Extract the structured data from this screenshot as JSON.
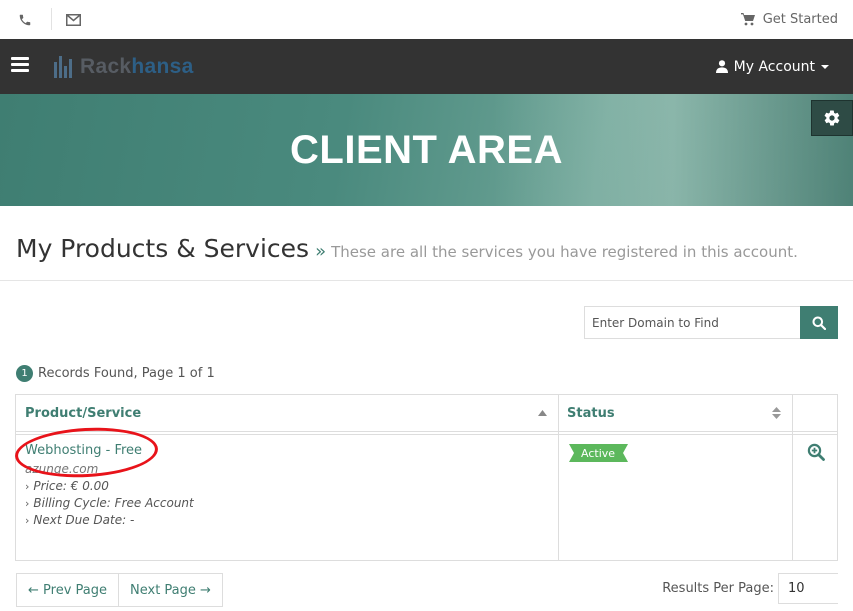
{
  "topbar": {
    "phone_icon": "phone-icon",
    "mail_icon": "envelope-icon",
    "get_started": "Get Started"
  },
  "navbar": {
    "logo": {
      "part1": "Rack",
      "part2": "hansa"
    },
    "account": "My Account"
  },
  "hero": {
    "title": "CLIENT AREA"
  },
  "page": {
    "title": "My Products & Services",
    "separator": "»",
    "subtitle": "These are all the services you have registered in this account."
  },
  "search": {
    "placeholder": "Enter Domain to Find"
  },
  "records": {
    "count": "1",
    "text": "Records Found, Page 1 of 1"
  },
  "table": {
    "headers": {
      "product": "Product/Service",
      "status": "Status"
    },
    "rows": [
      {
        "product": "Webhosting - Free",
        "domain": "azunge.com",
        "price": "Price: € 0.00",
        "billing": "Billing Cycle: Free Account",
        "due": "Next Due Date: -",
        "status": "Active"
      }
    ]
  },
  "pagination": {
    "prev": "← Prev Page",
    "next": "Next Page →"
  },
  "results_per_page": {
    "label": "Results Per Page:",
    "value": "10"
  },
  "colors": {
    "accent": "#3f7e72",
    "navbar": "#333333",
    "active": "#5cb85c",
    "annotation": "#e8131a"
  }
}
